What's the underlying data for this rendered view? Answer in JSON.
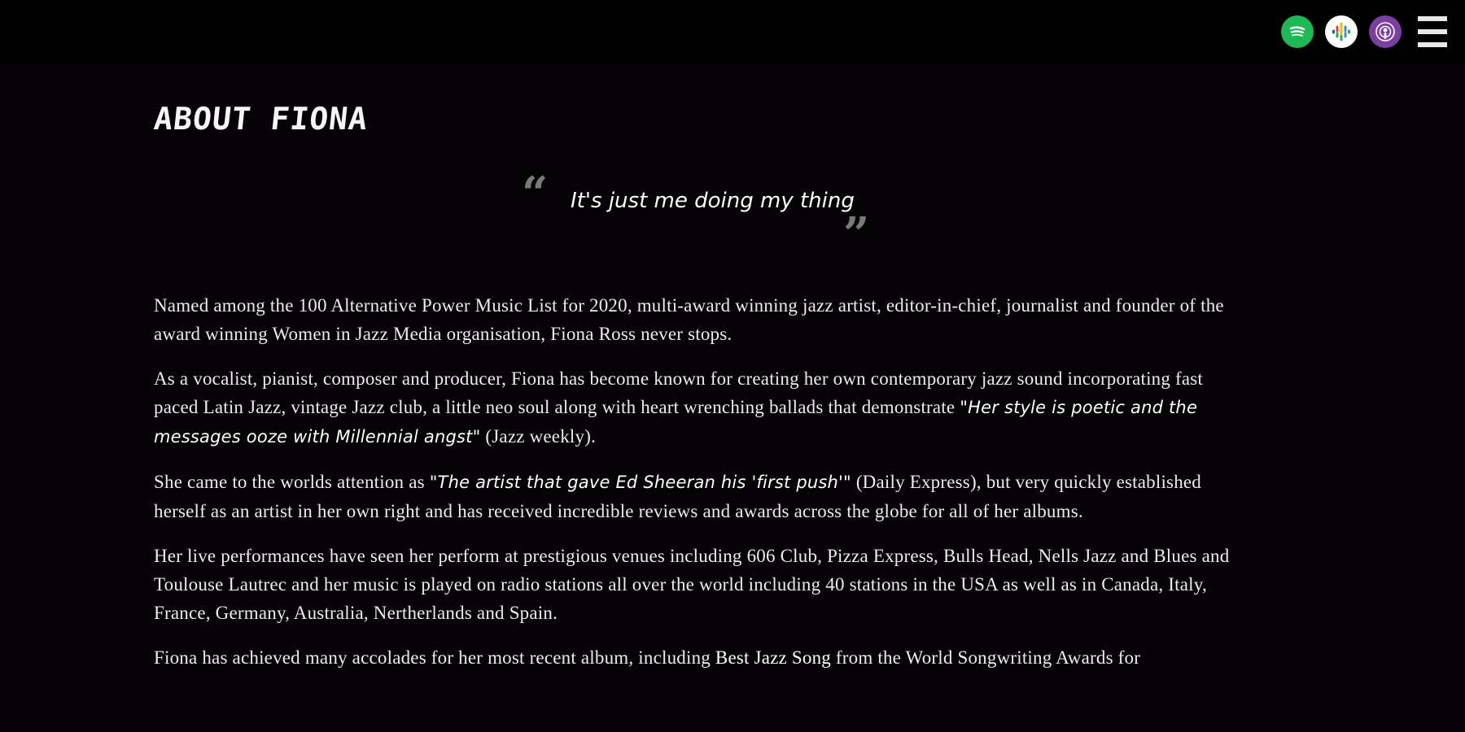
{
  "header": {
    "icons": [
      "spotify-icon",
      "google-podcasts-icon",
      "apple-podcasts-icon",
      "menu-icon"
    ],
    "colors": {
      "spotify": "#1db954",
      "google": "#ffffff",
      "apple": "#7b3fa0"
    }
  },
  "page": {
    "title": "About Fiona",
    "quote": "It's just me doing my thing",
    "quote_open": "“",
    "quote_close": "”"
  },
  "paragraphs": {
    "p1": "Named among the 100 Alternative Power Music List for 2020, multi-award winning jazz artist, editor-in-chief, journalist and founder of the award winning Women in Jazz Media organisation, Fiona Ross never stops.",
    "p2_a": "As a vocalist, pianist, composer and producer, Fiona has become known for creating her own contemporary jazz sound incorporating fast paced Latin Jazz, vintage Jazz club, a little neo soul along with heart wrenching ballads that demonstrate ",
    "p2_quote": "\"Her style is poetic and the messages ooze with Millennial angst\"",
    "p2_b": " (Jazz weekly).",
    "p3_a": "She came to the worlds attention as ",
    "p3_quote": "\"The artist that gave Ed Sheeran his 'first push'\"",
    "p3_b": " (Daily Express), but very quickly established herself as an artist in her own right and has received incredible reviews and awards across the globe for all of her albums.",
    "p4": "Her live performances have seen her perform at prestigious venues including 606 Club, Pizza Express, Bulls Head, Nells Jazz and Blues and Toulouse Lautrec and her music is played on radio stations all over the world including 40 stations in the USA as well as in Canada, Italy, France, Germany, Australia, Nertherlands and Spain.",
    "p5_a": "Fiona has achieved many accolades for her most recent album, including ",
    "p5_strong": "Best Jazz Song",
    "p5_b": " from the World Songwriting Awards for"
  }
}
